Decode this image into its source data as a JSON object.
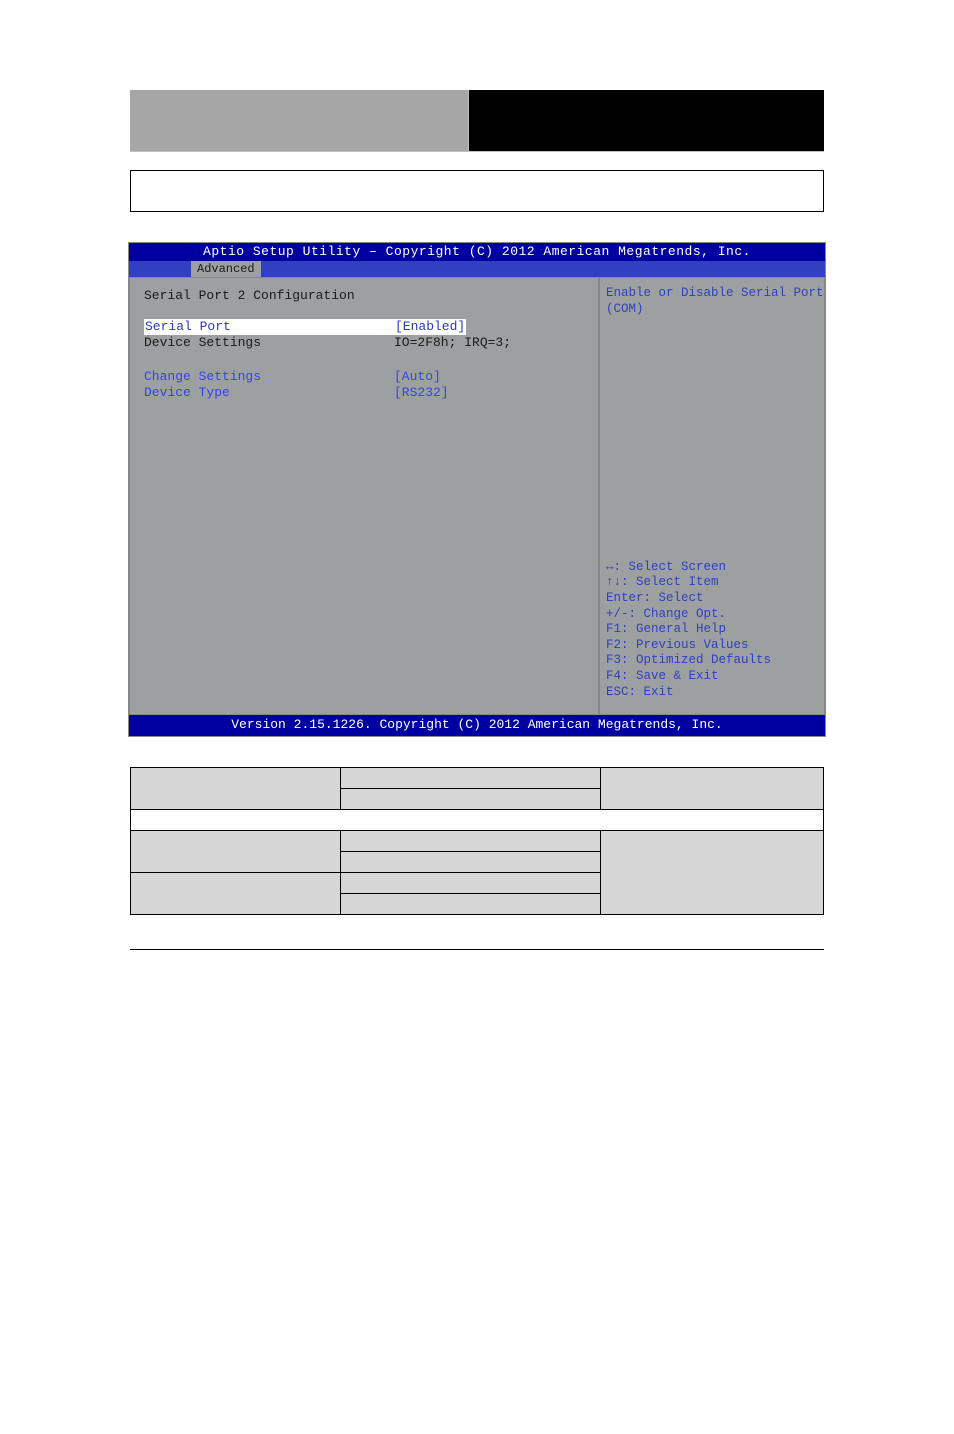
{
  "banner": {
    "right_text": ""
  },
  "thin_box": {
    "text": ""
  },
  "section": {
    "title": "",
    "sub": ""
  },
  "bios": {
    "title": "Aptio Setup Utility – Copyright (C) 2012 American Megatrends, Inc.",
    "tab": "Advanced",
    "heading": "Serial Port 2 Configuration",
    "rows": [
      {
        "label": "Serial Port",
        "value": "[Enabled]",
        "sel": true,
        "hl": true
      },
      {
        "label": "Device Settings",
        "value": "IO=2F8h; IRQ=3;",
        "sel": false
      }
    ],
    "rows2": [
      {
        "label": "Change Settings",
        "value": "[Auto]",
        "sel": true
      },
      {
        "label": "Device Type",
        "value": "[RS232]",
        "sel": true
      }
    ],
    "help": "Enable or Disable Serial Port\n(COM)",
    "keys": "↔: Select Screen\n↑↓: Select Item\nEnter: Select\n+/-: Change Opt.\nF1: General Help\nF2: Previous Values\nF3: Optimized Defaults\nF4: Save & Exit\nESC: Exit",
    "footer": "Version 2.15.1226. Copyright (C) 2012 American Megatrends, Inc."
  },
  "opts_label": "",
  "opts": [
    {
      "c1": "",
      "c2a": "",
      "c2b": "",
      "c3": "",
      "white": false
    },
    {
      "full": true,
      "text": ""
    },
    {
      "c1": "",
      "c2a": "",
      "c2b": "",
      "c3": "",
      "white": false
    },
    {
      "c1": "",
      "c2a": "",
      "c2b": "",
      "c3": "",
      "white": false
    }
  ],
  "footer": {
    "left": "",
    "right": ""
  }
}
